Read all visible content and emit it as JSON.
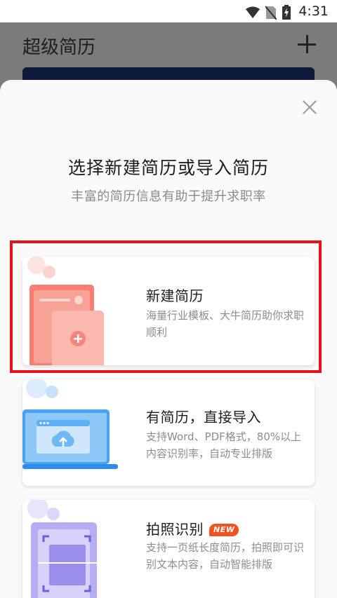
{
  "status_bar": {
    "time": "4:31",
    "icons": [
      "wifi-icon",
      "no-sim-icon",
      "battery-charging-icon"
    ]
  },
  "background": {
    "title": "超级简历",
    "add_icon": "plus-icon"
  },
  "dialog": {
    "close_icon": "close-icon",
    "title": "选择新建简历或导入简历",
    "subtitle": "丰富的简历信息有助于提升求职率",
    "options": [
      {
        "title": "新建简历",
        "description": "海量行业模板、大牛简历助你求职顺利",
        "illustration": "new-resume-illustration"
      },
      {
        "title": "有简历，直接导入",
        "description": "支持Word、PDF格式，80%以上内容识别率，自动专业排版",
        "illustration": "laptop-upload-illustration"
      },
      {
        "title": "拍照识别",
        "badge": "NEW",
        "description": "支持一页纸长度简历，拍照即可识别文本内容，自动智能排版",
        "illustration": "photo-scan-illustration"
      }
    ]
  },
  "colors": {
    "highlight_border": "#e8121b",
    "badge": "#f4511e",
    "new_resume_accent": "#f27a6e",
    "import_accent": "#3b9af0",
    "scan_accent": "#7d72e8"
  }
}
